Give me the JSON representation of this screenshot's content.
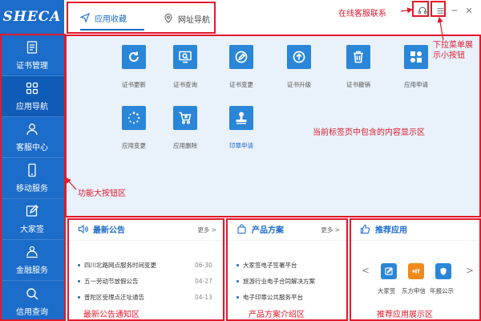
{
  "sidebar": {
    "logo_text": "SHECA",
    "items": [
      {
        "label": "证书管理",
        "icon": "certificate-icon"
      },
      {
        "label": "应用导航",
        "icon": "grid-icon"
      },
      {
        "label": "客服中心",
        "icon": "user-icon"
      },
      {
        "label": "移动服务",
        "icon": "mobile-icon"
      },
      {
        "label": "大家签",
        "icon": "sign-icon"
      },
      {
        "label": "金融服务",
        "icon": "finance-icon"
      },
      {
        "label": "信用查询",
        "icon": "search-icon"
      }
    ]
  },
  "topbar": {
    "tabs": [
      {
        "label": "应用收藏",
        "icon": "send-icon"
      },
      {
        "label": "网址导航",
        "icon": "location-icon"
      }
    ],
    "window_buttons": [
      "headset-icon",
      "menu-icon",
      "minimize-icon",
      "close-icon"
    ]
  },
  "apps": [
    {
      "label": "证书更新",
      "icon": "refresh-icon"
    },
    {
      "label": "证书查询",
      "icon": "monitor-search-icon"
    },
    {
      "label": "证书变更",
      "icon": "edit-circle-icon"
    },
    {
      "label": "证书升级",
      "icon": "upgrade-icon"
    },
    {
      "label": "证书撤销",
      "icon": "trash-icon"
    },
    {
      "label": "应用申请",
      "icon": "puzzle-icon"
    },
    {
      "label": "应用变更",
      "icon": "loading-icon"
    },
    {
      "label": "应用删除",
      "icon": "cart-icon"
    },
    {
      "label": "印章申请",
      "icon": "stamp-icon"
    }
  ],
  "news": {
    "title": "最新公告",
    "more": "更多 >",
    "items": [
      {
        "text": "四川北路网点服务时间变更",
        "date": "06-30"
      },
      {
        "text": "五一劳动节放假公告",
        "date": "04-27"
      },
      {
        "text": "普陀区受理点迁址通告",
        "date": "04-13"
      }
    ]
  },
  "products": {
    "title": "产品方案",
    "more": "更多 >",
    "items": [
      {
        "text": "大家签电子签署平台"
      },
      {
        "text": "旅游行业电子合同解决方案"
      },
      {
        "text": "电子印章公共服务平台"
      }
    ]
  },
  "recommend": {
    "title": "推荐应用",
    "prev": "<",
    "next": ">",
    "items": [
      {
        "label": "大家签",
        "color": "#2a86d8"
      },
      {
        "label": "东方申信",
        "color": "#f08a1c"
      },
      {
        "label": "年报公示",
        "color": "#2a86d8"
      }
    ]
  },
  "annotations": {
    "online_service": "在线客服联系",
    "dropdown_menu": "下拉菜单展示小按钮",
    "content_area": "当前标签页中包含的内容显示区",
    "function_buttons": "功能大按钮区",
    "news_area": "最新公告通知区",
    "products_area": "产品方案介绍区",
    "recommend_area": "推荐应用展示区"
  }
}
